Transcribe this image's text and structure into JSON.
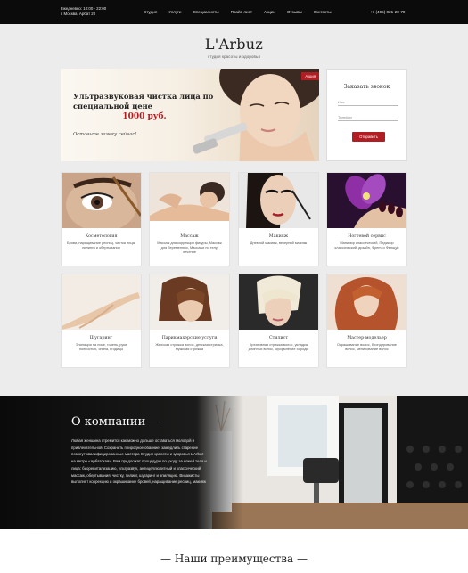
{
  "topbar": {
    "schedule": "Ежедневно: 10:00 - 22:00",
    "address": "г. Москва, Арбат 20",
    "nav": [
      "Студия",
      "Услуги",
      "Специалисты",
      "Прайс-лист",
      "Акции",
      "Отзывы",
      "Контакты"
    ],
    "phone": "+7 (495) 021-20-79"
  },
  "logo": {
    "name": "L'Arbuz",
    "tagline": "студия красоты и здоровья"
  },
  "hero": {
    "title": "Ультразвуковая чистка лица по специальной цене",
    "price": "1000 руб.",
    "slogan": "Оставьте заявку сейчас!",
    "badge": "Акция"
  },
  "callback": {
    "title": "Заказать звонок",
    "name_placeholder": "Имя",
    "phone_placeholder": "Телефон",
    "button": "Отправить"
  },
  "services": [
    {
      "title": "Косметология",
      "desc": "Брови, наращивание ресниц, чистка лица, пилинги и обертывания"
    },
    {
      "title": "Массаж",
      "desc": "Массаж для коррекции фигуры, Массаж для беременных, Массажи по телу, лечение"
    },
    {
      "title": "Макияж",
      "desc": "Дневной макияж, вечерний макияж"
    },
    {
      "title": "Ногтевой сервис",
      "desc": "Маникюр классический, Педикюр классический, дизайн, Френч и Фенщуй"
    },
    {
      "title": "Шугаринг",
      "desc": "Эпиляция на лице, голень, руки полностью, спина, ягодицы"
    },
    {
      "title": "Парикмахерские услуги",
      "desc": "Женская стрижка волос, детская стрижка, мужская стрижка"
    },
    {
      "title": "Стилист",
      "desc": "Креативная стрижка волос, укладка длинных волос, оформление бороды"
    },
    {
      "title": "Мастер-модельер",
      "desc": "Окрашивание волос, брондирование волос, мелирование волос"
    }
  ],
  "about": {
    "title": "О компании —",
    "text": "Любая женщина стремится как можно дольше оставаться молодой и привлекательной. Сохранить природное обаяние, замедлить старение помогут квалифицированные мастера Студии красоты и здоровья L'Arbuz на метро «Арбатская». Вам предложат процедуры по уходу за кожей тела и лица: биоревитализацию, ультразвук, антицеллюлитный и классический массаж, обертывания, чистку, пилинг, шугаринг и эпиляцию. Визажисты выполнят коррекцию и окрашивание бровей, наращивание ресниц, макияж"
  },
  "advantages": {
    "title": "— Наши преимущества —"
  },
  "colors": {
    "accent": "#b01e23",
    "topbar": "#0b0b0b"
  }
}
